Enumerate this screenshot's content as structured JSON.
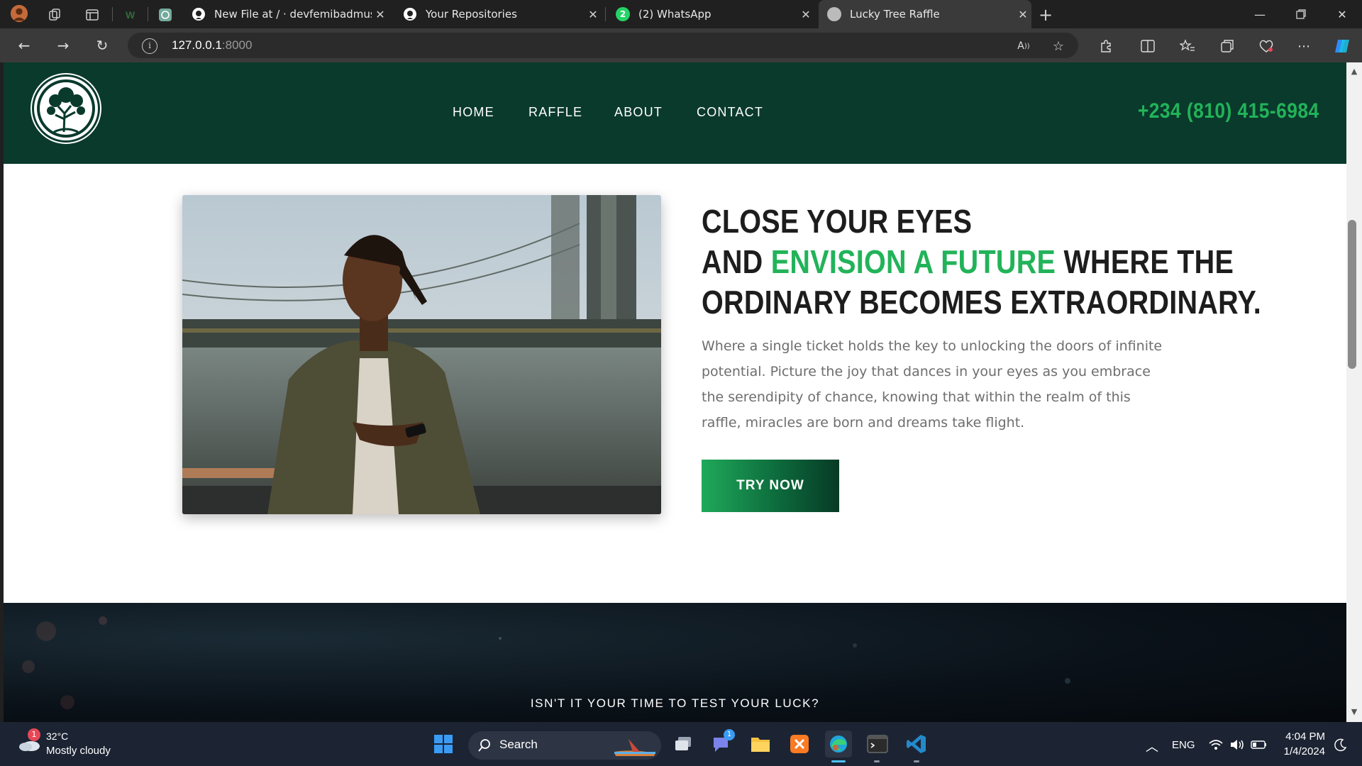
{
  "browser": {
    "tabs": [
      {
        "title": "New File at / · devfemibadmus/ra",
        "favicon": "github-icon"
      },
      {
        "title": "Your Repositories",
        "favicon": "github-icon"
      },
      {
        "title": "(2) WhatsApp",
        "favicon": "whatsapp-icon",
        "badge": "2"
      },
      {
        "title": "Lucky Tree Raffle",
        "favicon": "site-icon",
        "active": true
      }
    ],
    "url_host": "127.0.0.1",
    "url_port": ":8000"
  },
  "site": {
    "nav": [
      "HOME",
      "RAFFLE",
      "ABOUT",
      "CONTACT"
    ],
    "phone": "+234 (810) 415-6984",
    "headline": {
      "line1": "CLOSE YOUR EYES",
      "line2_start": "AND ",
      "line2_accent": "ENVISION A FUTURE",
      "line2_end": " WHERE THE",
      "line3": "ORDINARY BECOMES EXTRAORDINARY."
    },
    "description": "Where a single ticket holds the key to unlocking the doors of infinite potential. Picture the joy that dances in your eyes as you embrace the serendipity of chance, knowing that within the realm of this raffle, miracles are born and dreams take flight.",
    "cta": "TRY NOW",
    "band_text": "ISN'T IT YOUR TIME TO TEST YOUR LUCK?"
  },
  "taskbar": {
    "weather_badge": "1",
    "temperature": "32°C",
    "weather": "Mostly cloudy",
    "search": "Search",
    "chat_badge": "1",
    "language": "ENG",
    "time": "4:04 PM",
    "date": "1/4/2024"
  },
  "colors": {
    "header_bg": "#0a3a2c",
    "accent_green": "#22b359",
    "headline_text": "#1d1d1d",
    "body_text": "#6e6e6e"
  }
}
